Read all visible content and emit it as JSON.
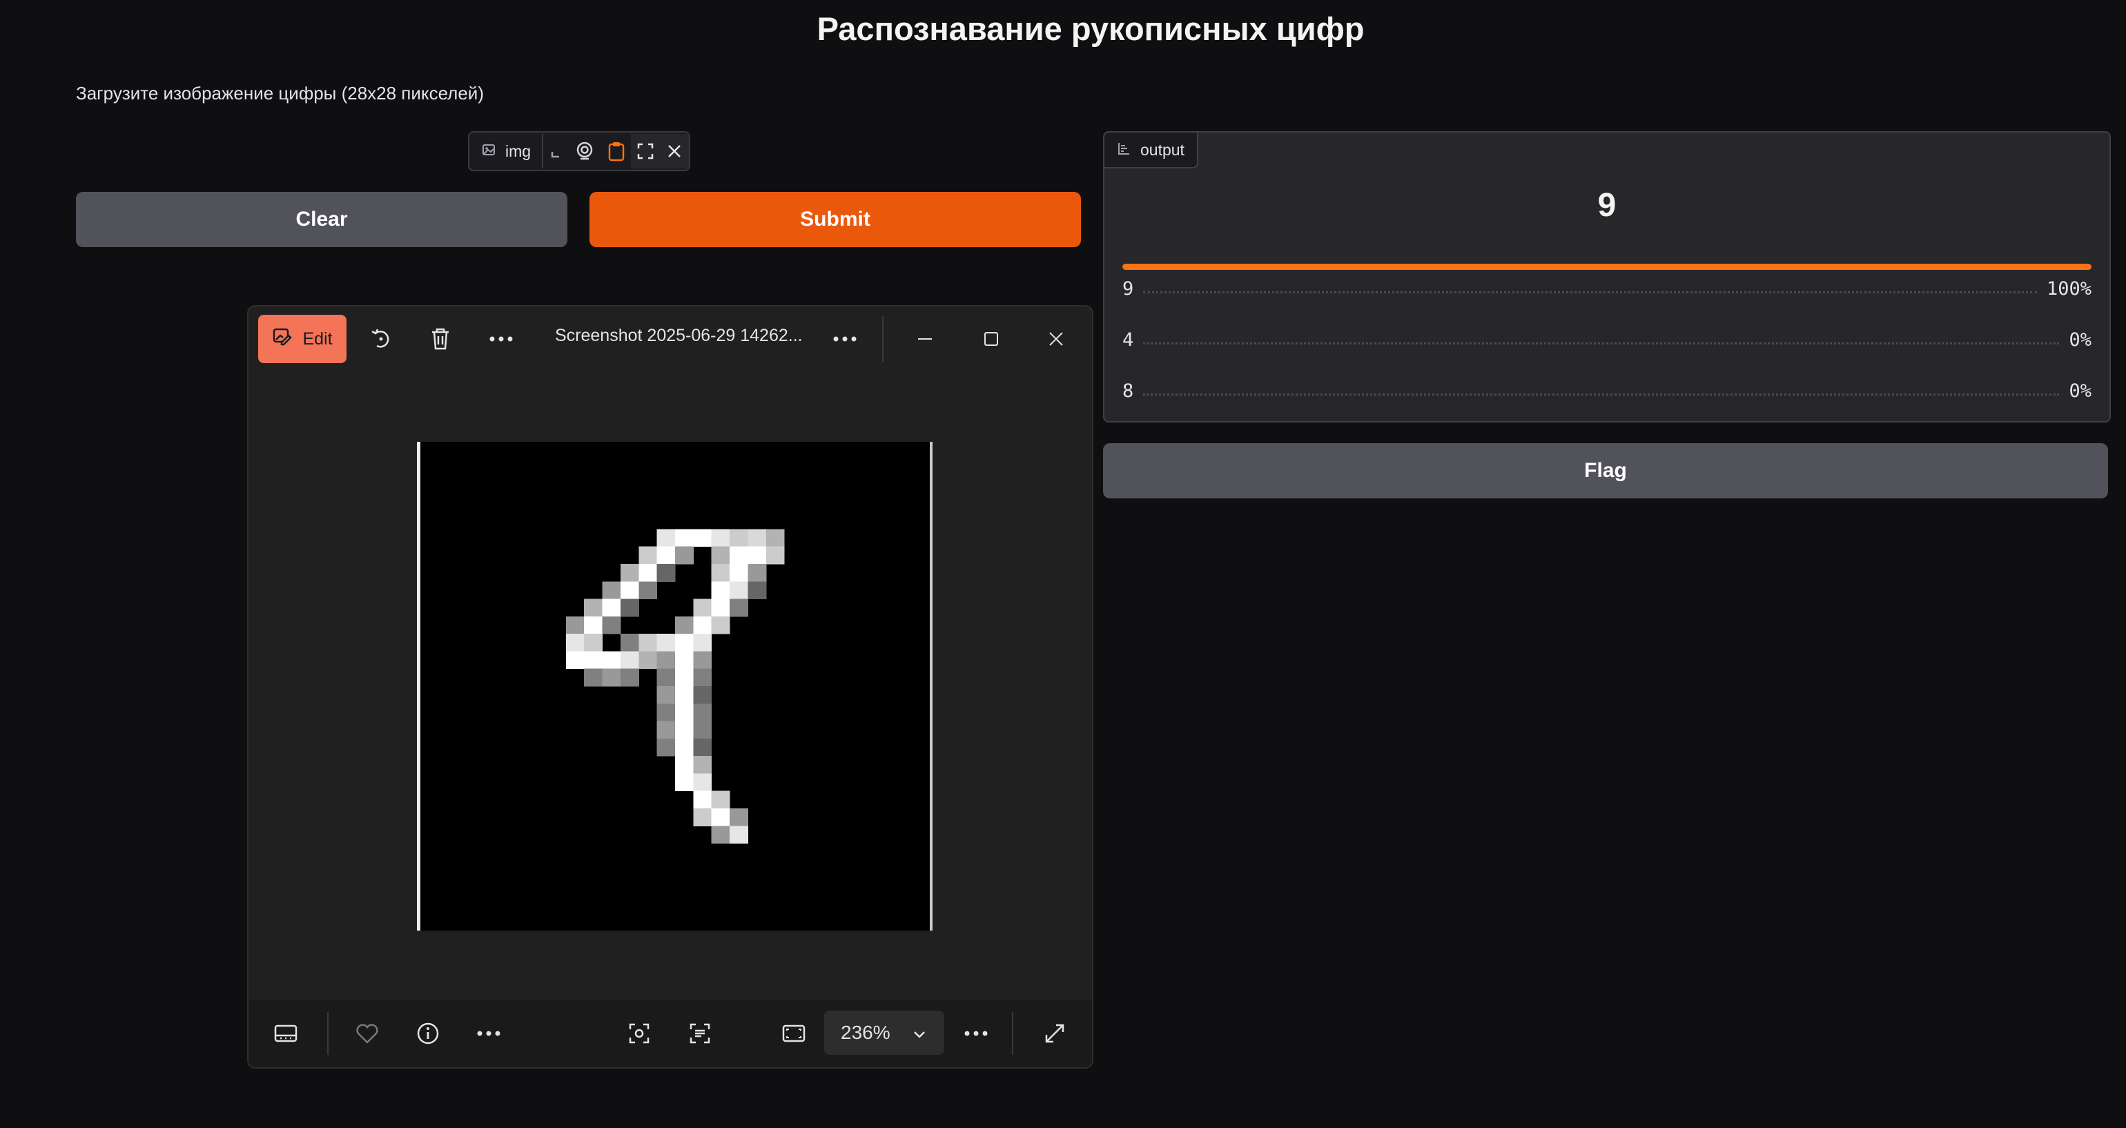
{
  "page": {
    "title": "Распознавание рукописных цифр",
    "subtitle": "Загрузите изображение цифры (28x28 пикселей)"
  },
  "input": {
    "label": "img",
    "icons": [
      "image-icon",
      "upload-icon",
      "webcam-icon",
      "clipboard-icon",
      "fullscreen-icon",
      "close-icon"
    ]
  },
  "buttons": {
    "clear": "Clear",
    "submit": "Submit",
    "flag": "Flag"
  },
  "output": {
    "label": "output",
    "top_label": "9",
    "top_confidence": 1.0,
    "confidences": [
      {
        "label": "9",
        "value": "100%"
      },
      {
        "label": "4",
        "value": "0%"
      },
      {
        "label": "8",
        "value": "0%"
      }
    ]
  },
  "viewer": {
    "edit_label": "Edit",
    "file_title": "Screenshot 2025-06-29 14262...",
    "zoom": "236%",
    "digit_shown": "9"
  },
  "colors": {
    "background": "#0f0f11",
    "accent": "#ea580c",
    "secondary_button": "#52525b",
    "edit_button": "#f47458"
  }
}
